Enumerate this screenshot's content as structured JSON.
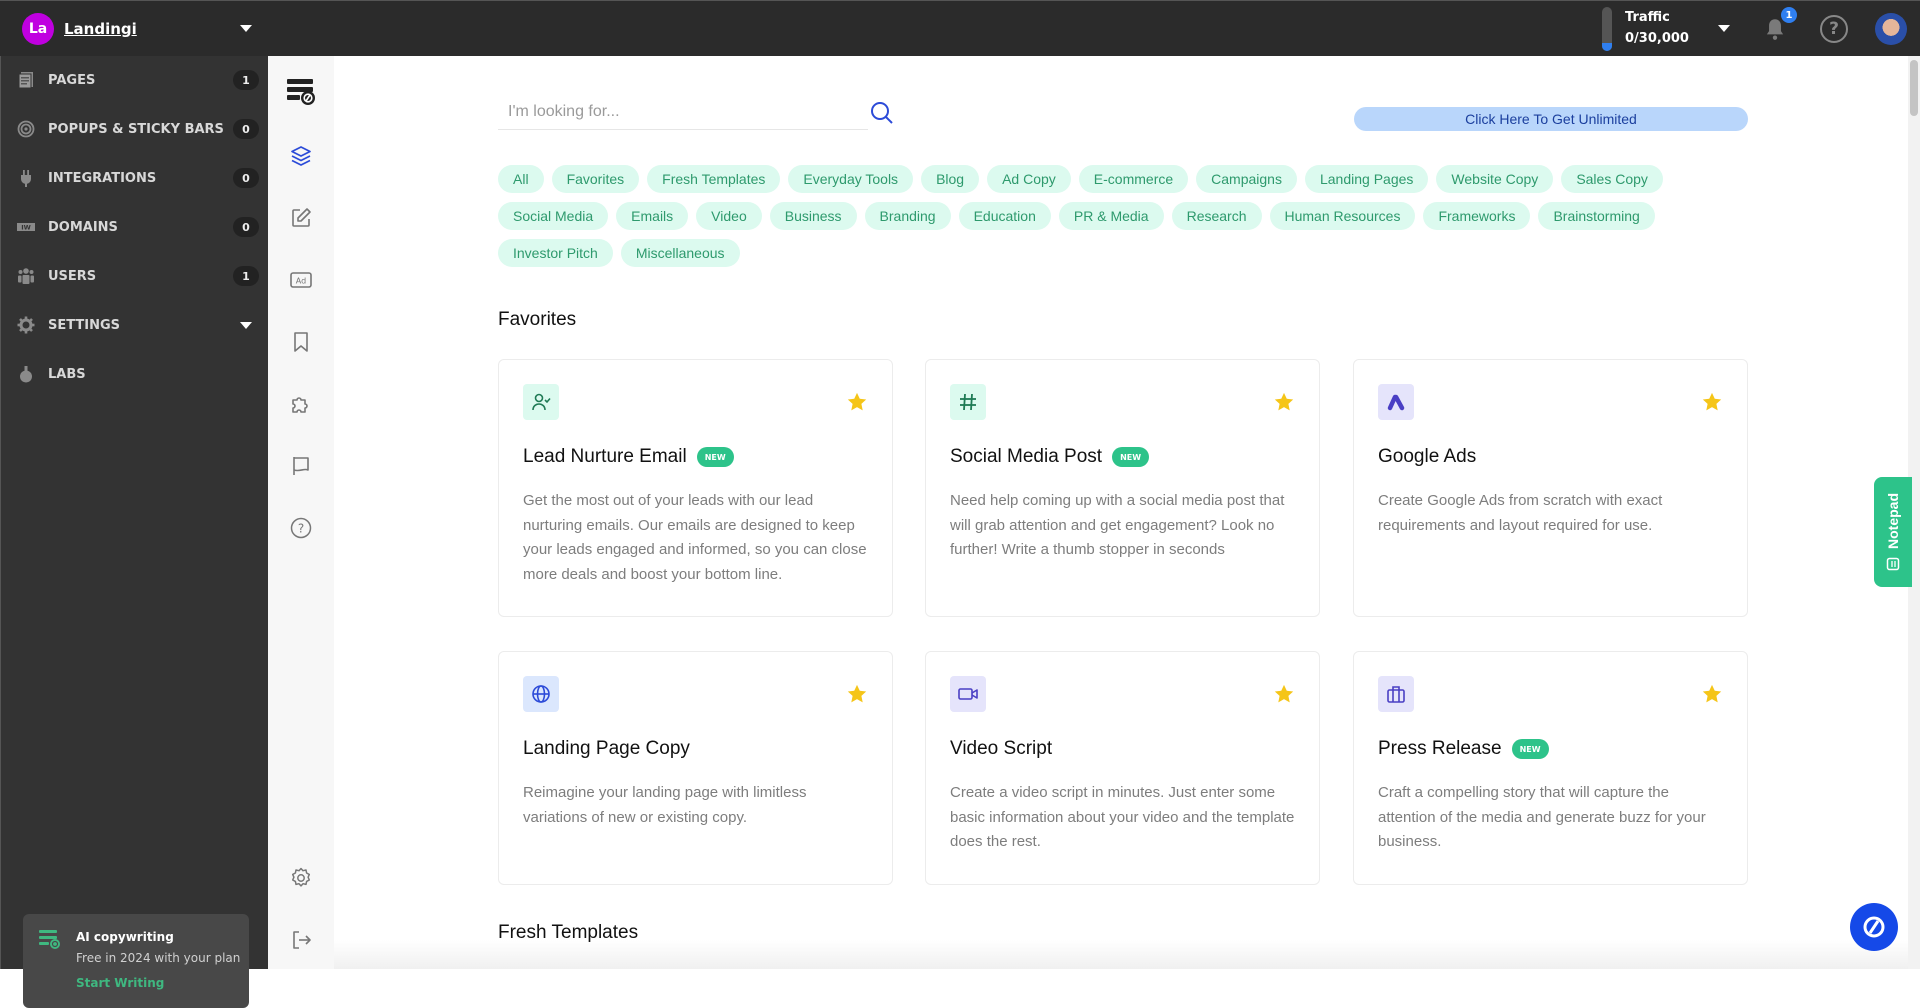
{
  "topbar": {
    "brand_initials": "La",
    "brand_name": "Landingi",
    "traffic_label": "Traffic",
    "traffic_value": "0/30,000",
    "traffic_usage_fraction": 0.0,
    "notifications_count": "1",
    "help_glyph": "?"
  },
  "sidebar": {
    "items": [
      {
        "label": "PAGES",
        "icon": "pages-icon",
        "count": "1"
      },
      {
        "label": "POPUPS & STICKY BARS",
        "icon": "target-icon",
        "count": "0"
      },
      {
        "label": "INTEGRATIONS",
        "icon": "plug-icon",
        "count": "0"
      },
      {
        "label": "DOMAINS",
        "icon": "domain-icon",
        "count": "0"
      },
      {
        "label": "USERS",
        "icon": "users-icon",
        "count": "1"
      },
      {
        "label": "SETTINGS",
        "icon": "gear-icon"
      },
      {
        "label": "LABS",
        "icon": "flask-icon"
      }
    ],
    "promo": {
      "title": "AI copywriting",
      "subtitle": "Free in 2024 with your plan",
      "link": "Start Writing"
    }
  },
  "iconbar": {
    "items": [
      "ai-writer-logo-icon",
      "layers-icon",
      "edit-icon",
      "ad-icon",
      "bookmark-icon",
      "puzzle-icon",
      "flag-icon",
      "help-circle-icon"
    ],
    "ad_text": "Ad",
    "bottom": [
      "settings-icon",
      "logout-icon"
    ],
    "active": "layers-icon"
  },
  "main": {
    "search": {
      "placeholder": "I'm looking for...",
      "value": ""
    },
    "unlimited_button": "Click Here To Get Unlimited",
    "categories": [
      "All",
      "Favorites",
      "Fresh Templates",
      "Everyday Tools",
      "Blog",
      "Ad Copy",
      "E-commerce",
      "Campaigns",
      "Landing Pages",
      "Website Copy",
      "Sales Copy",
      "Social Media",
      "Emails",
      "Video",
      "Business",
      "Branding",
      "Education",
      "PR & Media",
      "Research",
      "Human Resources",
      "Frameworks",
      "Brainstorming",
      "Investor Pitch",
      "Miscellaneous"
    ],
    "favorites_title": "Favorites",
    "fresh_title": "Fresh Templates",
    "new_badge": "NEW",
    "cards": [
      {
        "title": "Lead Nurture Email",
        "new": true,
        "icon": "user-check-icon",
        "favorite": true,
        "description": "Get the most out of your leads with our lead nurturing emails. Our emails are designed to keep your leads engaged and informed, so you can close more deals and boost your bottom line."
      },
      {
        "title": "Social Media Post",
        "new": true,
        "icon": "hashtag-icon",
        "favorite": true,
        "description": "Need help coming up with a social media post that will grab attention and get engagement? Look no further! Write a thumb stopper in seconds"
      },
      {
        "title": "Google Ads",
        "new": false,
        "icon": "google-ads-icon",
        "favorite": true,
        "description": "Create Google Ads from scratch with exact requirements and layout required for use."
      },
      {
        "title": "Landing Page Copy",
        "new": false,
        "icon": "globe-icon",
        "favorite": true,
        "description": "Reimagine your landing page with limitless variations of new or existing copy."
      },
      {
        "title": "Video Script",
        "new": false,
        "icon": "video-icon",
        "favorite": true,
        "description": "Create a video script in minutes. Just enter some basic information about your video and the template does the rest."
      },
      {
        "title": "Press Release",
        "new": true,
        "icon": "briefcase-icon",
        "favorite": true,
        "description": "Craft a compelling story that will capture the attention of the media and generate buzz for your business."
      }
    ]
  },
  "notepad": {
    "label": "Notepad"
  },
  "colors": {
    "accent_green": "#2dc38a",
    "chip_bg": "#dcfaef",
    "chip_text": "#2e9a6d",
    "star": "#f5c518",
    "primary_blue": "#1549e8",
    "sidebar_bg": "#333333",
    "topbar_bg": "#2b2b2b"
  }
}
